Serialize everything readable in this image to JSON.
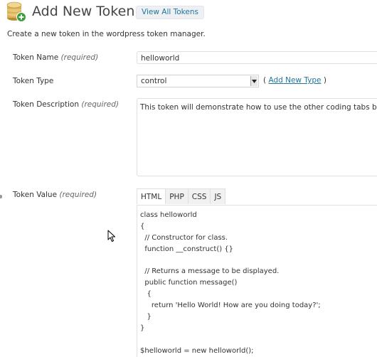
{
  "header": {
    "title": "Add New Token",
    "view_all_label": "View All Tokens",
    "icon": "coin-stack-add-icon"
  },
  "intro": "Create a new token in the wordpress token manager.",
  "fields": {
    "name": {
      "label": "Token Name",
      "required": "(required)",
      "value": "helloworld"
    },
    "type": {
      "label": "Token Type",
      "selected": "control",
      "add_prefix": "(",
      "add_link": "Add New Type",
      "add_suffix": ")"
    },
    "description": {
      "label": "Token Description",
      "required": "(required)",
      "value": "This token will demonstrate how to use the other coding tabs below."
    },
    "value": {
      "label": "Token Value",
      "required": "(required)",
      "tabs": [
        "HTML",
        "PHP",
        "CSS",
        "JS"
      ],
      "active_tab": "HTML",
      "code_lines": [
        "class helloworld",
        "{",
        "  // Constructor for class.",
        "  function __construct() {}",
        "",
        "  // Returns a message to be displayed.",
        "  public function message()",
        "   {",
        "     return 'Hello World! How are you doing today?';",
        "   }",
        "}",
        "",
        "$helloworld = new helloworld();"
      ]
    }
  },
  "colors": {
    "link": "#21759b",
    "title": "#464646",
    "border": "#dfdfdf",
    "coin_gold": "#d9b25a",
    "badge_green": "#3f9b3f"
  }
}
